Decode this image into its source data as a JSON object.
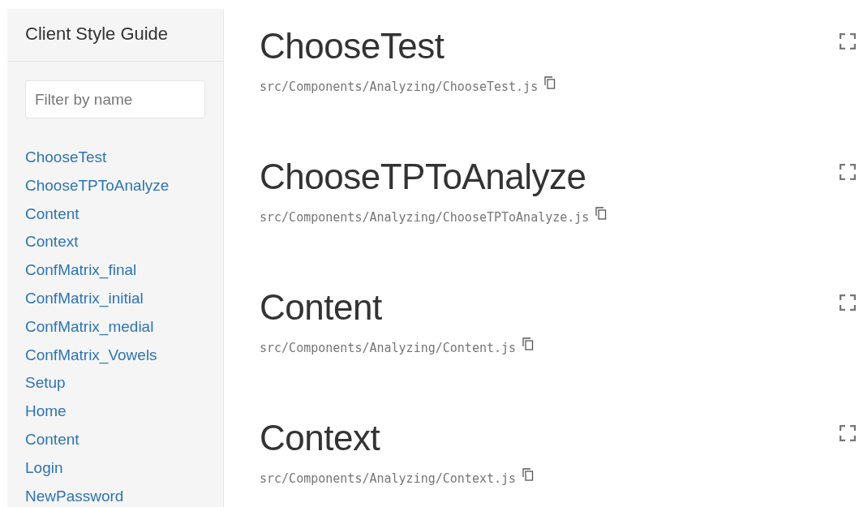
{
  "sidebar": {
    "title": "Client Style Guide",
    "filter": {
      "placeholder": "Filter by name"
    },
    "items": [
      {
        "label": "ChooseTest"
      },
      {
        "label": "ChooseTPToAnalyze"
      },
      {
        "label": "Content"
      },
      {
        "label": "Context"
      },
      {
        "label": "ConfMatrix_final"
      },
      {
        "label": "ConfMatrix_initial"
      },
      {
        "label": "ConfMatrix_medial"
      },
      {
        "label": "ConfMatrix_Vowels"
      },
      {
        "label": "Setup"
      },
      {
        "label": "Home"
      },
      {
        "label": "Content"
      },
      {
        "label": "Login"
      },
      {
        "label": "NewPassword"
      }
    ]
  },
  "components": [
    {
      "name": "ChooseTest",
      "path": "src/Components/Analyzing/ChooseTest.js"
    },
    {
      "name": "ChooseTPToAnalyze",
      "path": "src/Components/Analyzing/ChooseTPToAnalyze.js"
    },
    {
      "name": "Content",
      "path": "src/Components/Analyzing/Content.js"
    },
    {
      "name": "Context",
      "path": "src/Components/Analyzing/Context.js"
    }
  ]
}
